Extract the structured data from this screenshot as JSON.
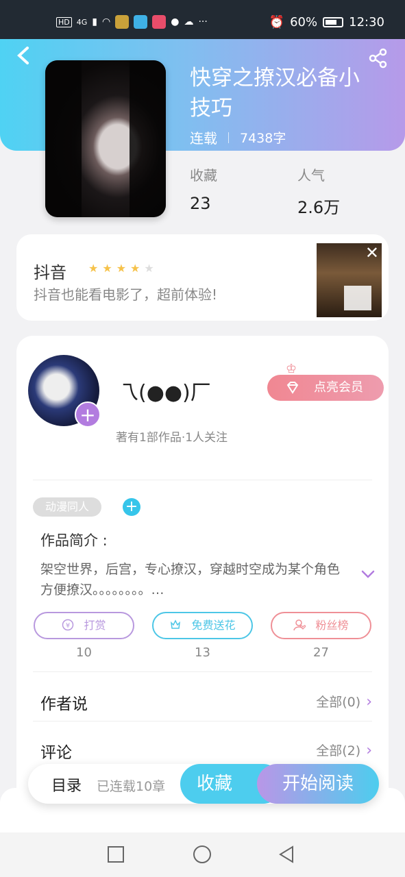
{
  "status_bar": {
    "left": "HD",
    "signal": "4G",
    "dots": "···",
    "alarm_icon": "alarm-icon",
    "battery": "60%",
    "time": "12:30"
  },
  "book": {
    "title": "快穿之撩汉必备小技巧",
    "status": "连载",
    "words": "7438字",
    "stats": [
      {
        "label": "收藏",
        "value": "23"
      },
      {
        "label": "人气",
        "value": "2.6万"
      }
    ]
  },
  "ad": {
    "title": "抖音",
    "rating": 4,
    "desc": "抖音也能看电影了，超前体验!",
    "close": "✕"
  },
  "author": {
    "name": "乁(●●)厂",
    "sub": "著有1部作品·1人关注",
    "vip_label": "点亮会员"
  },
  "tag": "动漫同人",
  "intro": {
    "heading": "作品简介 :",
    "body": "架空世界，后宫，专心撩汉，穿越时空成为某个角色方便撩汉。。。。。。。。…"
  },
  "actions": [
    {
      "label": "打赏",
      "count": "10",
      "color": "#b898de"
    },
    {
      "label": "免费送花",
      "count": "13",
      "color": "#4cc6e6"
    },
    {
      "label": "粉丝榜",
      "count": "27",
      "color": "#ef8f96"
    }
  ],
  "rows": [
    {
      "label": "作者说",
      "more": "全部(0)"
    },
    {
      "label": "评论",
      "more": "全部(2)"
    }
  ],
  "bottom_bar": {
    "toc": "目录",
    "count": "已连载10章",
    "fav": "收藏",
    "read": "开始阅读"
  }
}
